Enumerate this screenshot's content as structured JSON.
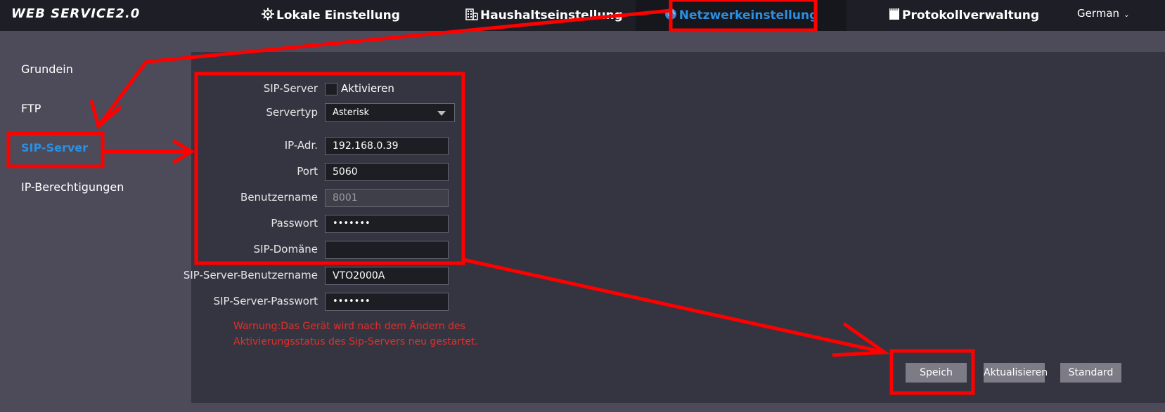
{
  "header": {
    "logo": "WEB SERVICE2.0",
    "nav": [
      {
        "label": "Lokale Einstellung",
        "icon": "gear-icon"
      },
      {
        "label": "Haushaltseinstellung",
        "icon": "building-icon"
      },
      {
        "label": "Netzwerkeinstellung",
        "icon": "globe-icon",
        "active": true
      },
      {
        "label": "Protokollverwaltung",
        "icon": "document-icon"
      }
    ],
    "language": "German"
  },
  "sidebar": {
    "items": [
      {
        "label": "Grundein"
      },
      {
        "label": "FTP"
      },
      {
        "label": "SIP-Server",
        "active": true
      },
      {
        "label": "IP-Berechtigungen"
      }
    ]
  },
  "form": {
    "sip_server_label": "SIP-Server",
    "enable_label": "Aktivieren",
    "enabled": false,
    "servertyp_label": "Servertyp",
    "servertyp_value": "Asterisk",
    "ip_label": "IP-Adr.",
    "ip_value": "192.168.0.39",
    "port_label": "Port",
    "port_value": "5060",
    "username_label": "Benutzername",
    "username_value": "8001",
    "password_label": "Passwort",
    "password_value": "•••••••",
    "domain_label": "SIP-Domäne",
    "domain_value": "",
    "server_username_label": "SIP-Server-Benutzername",
    "server_username_value": "VTO2000A",
    "server_password_label": "SIP-Server-Passwort",
    "server_password_value": "•••••••"
  },
  "warning": {
    "line1": "Warnung:Das Gerät wird nach dem Ändern des",
    "line2": "Aktivierungsstatus des Sip-Servers neu gestartet."
  },
  "buttons": {
    "save": "Speich",
    "refresh": "Aktualisieren",
    "default": "Standard"
  },
  "colors": {
    "accent": "#2c8fe0",
    "annotation": "#ff0000",
    "warning": "#e0302a"
  }
}
